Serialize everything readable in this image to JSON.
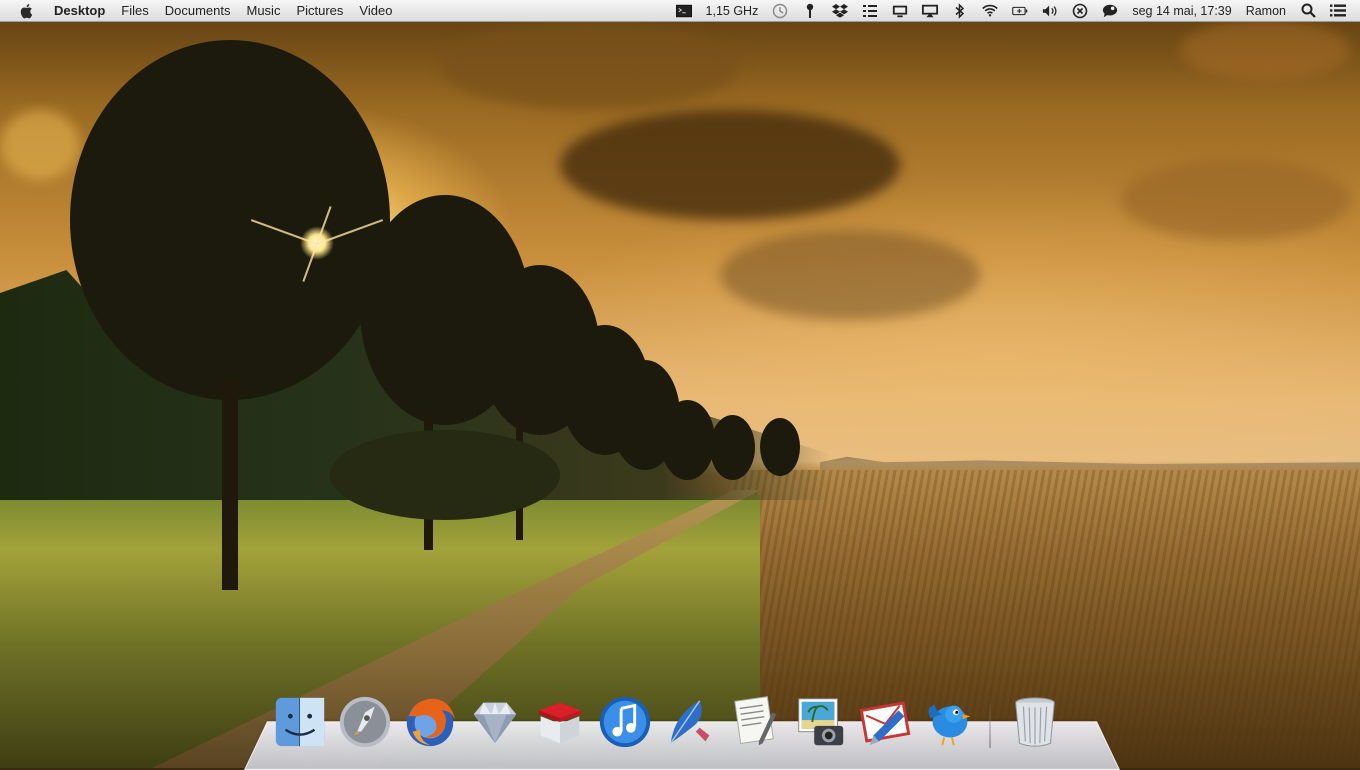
{
  "menubar": {
    "app_name": "Desktop",
    "menus": [
      "Files",
      "Documents",
      "Music",
      "Pictures",
      "Video"
    ],
    "cpu_freq": "1,15 GHz",
    "datetime": "seg 14 mai, 17:39",
    "user": "Ramon"
  },
  "status_icons": [
    "terminal-icon",
    "time-machine-icon",
    "pin-icon",
    "dropbox-icon",
    "list-icon",
    "display-icon",
    "airplay-icon",
    "bluetooth-icon",
    "wifi-icon",
    "battery-icon",
    "volume-icon",
    "close-circle-icon",
    "chat-icon",
    "search-icon",
    "menu-icon"
  ],
  "dock": {
    "apps": [
      "finder-icon",
      "launchpad-icon",
      "firefox-icon",
      "sketch-icon",
      "package-box-icon",
      "itunes-icon",
      "feather-pen-icon",
      "text-editor-icon",
      "image-capture-icon",
      "mail-icon",
      "twitter-bird-icon"
    ],
    "trash": "trash-icon"
  },
  "colors": {
    "menubar_bg": "#e9e9e9",
    "menubar_text": "#222222",
    "dock_shelf": "#dcdde3"
  }
}
